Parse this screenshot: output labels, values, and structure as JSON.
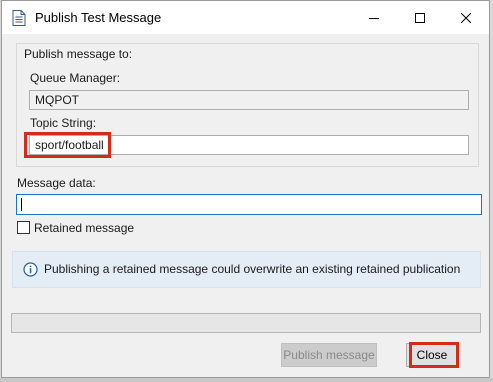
{
  "window": {
    "title": "Publish Test Message",
    "icon": "document-icon"
  },
  "publish_group": {
    "heading": "Publish message to:",
    "queue_manager_label": "Queue Manager:",
    "queue_manager_value": "MQPOT",
    "topic_string_label": "Topic String:",
    "topic_string_value": "sport/football"
  },
  "message": {
    "label": "Message data:",
    "value": ""
  },
  "retained": {
    "label": "Retained message",
    "checked": false
  },
  "info": {
    "icon": "info-icon",
    "text": "Publishing a retained message could overwrite an existing retained publication"
  },
  "status": {
    "text": ""
  },
  "buttons": {
    "publish_label": "Publish message",
    "close_label": "Close"
  },
  "colors": {
    "highlight": "#d22d1a",
    "focus_border": "#1a73c9",
    "info_background": "#e4ecf6"
  }
}
